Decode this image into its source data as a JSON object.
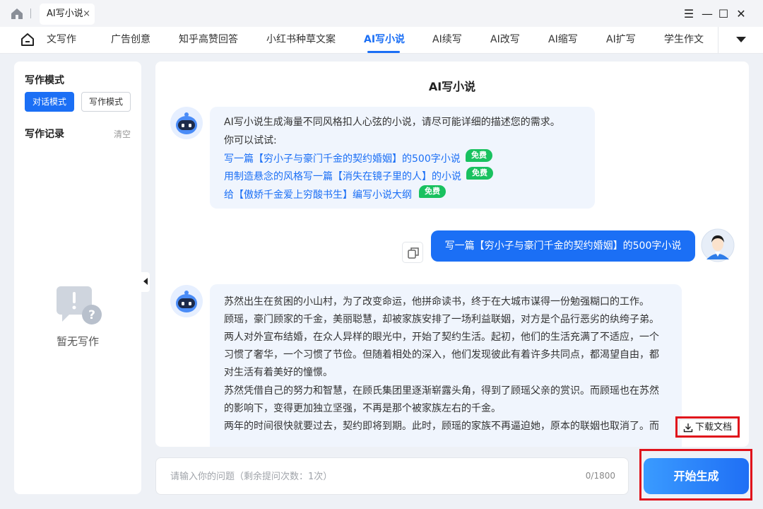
{
  "titlebar": {
    "tab_label": "AI写小说",
    "tab_close": "×",
    "window_buttons": [
      "☰",
      "—",
      "☐",
      "✕"
    ]
  },
  "nav": {
    "items": [
      "文写作",
      "广告创意",
      "知乎高赞回答",
      "小红书种草文案",
      "AI写小说",
      "AI续写",
      "AI改写",
      "AI缩写",
      "AI扩写",
      "学生作文"
    ],
    "active": "AI写小说"
  },
  "sidebar": {
    "mode_heading": "写作模式",
    "mode_chat": "对话模式",
    "mode_write": "写作模式",
    "records_heading": "写作记录",
    "clear": "清空",
    "empty_text": "暂无写作"
  },
  "chat": {
    "title": "AI写小说",
    "intro": "AI写小说生成海量不同风格扣人心弦的小说，请尽可能详细的描述您的需求。",
    "try_label": "你可以试试:",
    "suggestions": [
      {
        "text": "写一篇【穷小子与豪门千金的契约婚姻】的500字小说",
        "badge": "免费"
      },
      {
        "text": "用制造悬念的风格写一篇【消失在镜子里的人】的小说",
        "badge": "免费"
      },
      {
        "text": "给【傲娇千金爱上穷酸书生】编写小说大纲",
        "badge": "免费"
      }
    ],
    "user_message": "写一篇【穷小子与豪门千金的契约婚姻】的500字小说",
    "story_lines": [
      "苏然出生在贫困的小山村，为了改变命运，他拼命读书，终于在大城市谋得一份勉强糊口的工作。",
      "顾瑶，豪门顾家的千金，美丽聪慧，却被家族安排了一场利益联姻，对方是个品行恶劣的纨绔子弟。",
      "两人对外宣布结婚，在众人异样的眼光中，开始了契约生活。起初，他们的生活充满了不适应，一个",
      "习惯了奢华，一个习惯了节俭。但随着相处的深入，他们发现彼此有着许多共同点，都渴望自由，都",
      "对生活有着美好的憧憬。",
      "苏然凭借自己的努力和智慧，在顾氏集团里逐渐崭露头角，得到了顾瑶父亲的赏识。而顾瑶也在苏然",
      "的影响下，变得更加独立坚强，不再是那个被家族左右的千金。",
      "两年的时间很快就要过去，契约即将到期。此时，顾瑶的家族不再逼迫她，原本的联姻也取消了。而"
    ],
    "download_label": "下载文档"
  },
  "input": {
    "placeholder": "请输入你的问题（剩余提问次数：1次）",
    "value": "",
    "counter": "0/1800",
    "submit_label": "开始生成"
  },
  "colors": {
    "accent": "#1b6ff5",
    "badge_green": "#19c15f",
    "bubble_bg": "#f0f5fd",
    "highlight_red": "#e0121b"
  },
  "icons": [
    "home-icon",
    "robot-avatar-icon",
    "user-avatar-icon",
    "copy-icon",
    "download-icon",
    "empty-chat-icon",
    "collapse-arrow-icon",
    "menu-icon",
    "minimize-icon",
    "maximize-icon",
    "close-icon"
  ]
}
